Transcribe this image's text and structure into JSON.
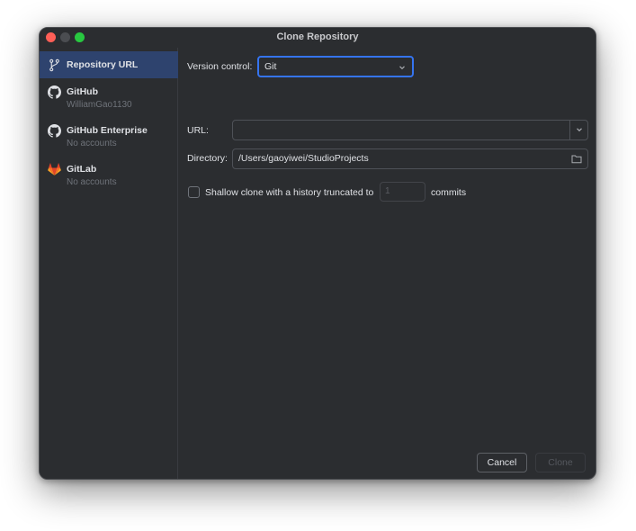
{
  "window": {
    "title": "Clone Repository"
  },
  "sidebar": {
    "items": [
      {
        "label": "Repository URL",
        "sub": "",
        "icon": "branch-icon",
        "selected": true
      },
      {
        "label": "GitHub",
        "sub": "WilliamGao1130",
        "icon": "github-icon",
        "selected": false
      },
      {
        "label": "GitHub Enterprise",
        "sub": "No accounts",
        "icon": "github-icon",
        "selected": false
      },
      {
        "label": "GitLab",
        "sub": "No accounts",
        "icon": "gitlab-icon",
        "selected": false
      }
    ]
  },
  "form": {
    "version_control_label": "Version control:",
    "version_control_value": "Git",
    "url_label": "URL:",
    "url_value": "",
    "directory_label": "Directory:",
    "directory_value": "/Users/gaoyiwei/StudioProjects",
    "shallow_label": "Shallow clone with a history truncated to",
    "shallow_checked": false,
    "shallow_depth": "1",
    "commits_label": "commits"
  },
  "buttons": {
    "cancel": "Cancel",
    "clone": "Clone"
  },
  "colors": {
    "accent": "#3574f0",
    "selection": "#2e436e",
    "background": "#2b2d30"
  }
}
